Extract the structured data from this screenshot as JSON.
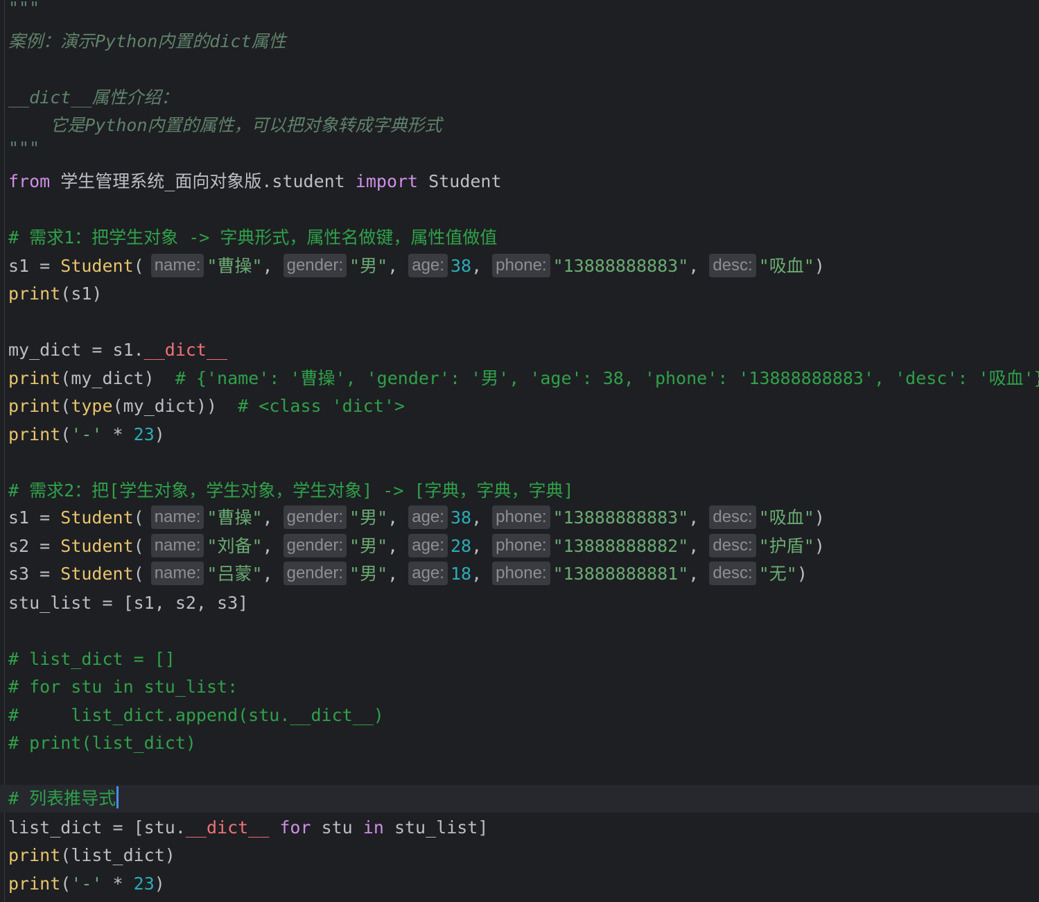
{
  "editor": {
    "doc_open": "\"\"\"",
    "doc_title": "案例：演示Python内置的dict属性",
    "doc_heading": "__dict__属性介绍：",
    "doc_desc": "    它是Python内置的属性，可以把对象转成字典形式",
    "doc_close": "\"\"\"",
    "import_from": "from",
    "import_module": " 学生管理系统_面向对象版.student ",
    "import_kw": "import",
    "import_name": " Student",
    "comment_req1": "# 需求1：把学生对象 -> 字典形式，属性名做键，属性值做值",
    "comment_req2": "# 需求2：把[学生对象，学生对象，学生对象] -> [字典，字典，字典]",
    "comment_list_dict": "# list_dict = []",
    "comment_for": "# for stu in stu_list:",
    "comment_append": "#     list_dict.append(stu.__dict__)",
    "comment_print": "# print(list_dict)",
    "comment_comprehension": "# 列表推导式",
    "print_fn": "print",
    "type_fn": "type",
    "student_cls": "Student",
    "dunder": "__dict__",
    "var_my_dict": "my_dict = s1.",
    "print_s1_args": "(s1)",
    "print_my_dict_args": "(my_dict)  ",
    "comment_my_dict": "# {'name': '曹操', 'gender': '男', 'age': 38, 'phone': '13888888883', 'desc': '吸血'}",
    "comment_type": "# <class 'dict'>",
    "sep_str": "'-'",
    "sep_mul": " * ",
    "sep_num": "23",
    "stu_list": "stu_list = [s1, s2, s3]",
    "comprehension_start": "list_dict = [stu.",
    "for_kw": "for",
    "in_kw": "in",
    "print_list_dict_args": "(list_dict)",
    "hints": {
      "name": "name:",
      "gender": "gender:",
      "age": "age:",
      "phone": "phone:",
      "desc": "desc:"
    },
    "students_req1": [
      {
        "var": "s1",
        "name": "\"曹操\"",
        "gender": "\"男\"",
        "age": "38",
        "phone": "\"13888888883\"",
        "desc": "\"吸血\""
      }
    ],
    "students_req2": [
      {
        "var": "s1",
        "name": "\"曹操\"",
        "gender": "\"男\"",
        "age": "38",
        "phone": "\"13888888883\"",
        "desc": "\"吸血\""
      },
      {
        "var": "s2",
        "name": "\"刘备\"",
        "gender": "\"男\"",
        "age": "28",
        "phone": "\"13888888882\"",
        "desc": "\"护盾\""
      },
      {
        "var": "s3",
        "name": "\"吕蒙\"",
        "gender": "\"男\"",
        "age": "18",
        "phone": "\"13888888881\"",
        "desc": "\"无\""
      }
    ]
  }
}
